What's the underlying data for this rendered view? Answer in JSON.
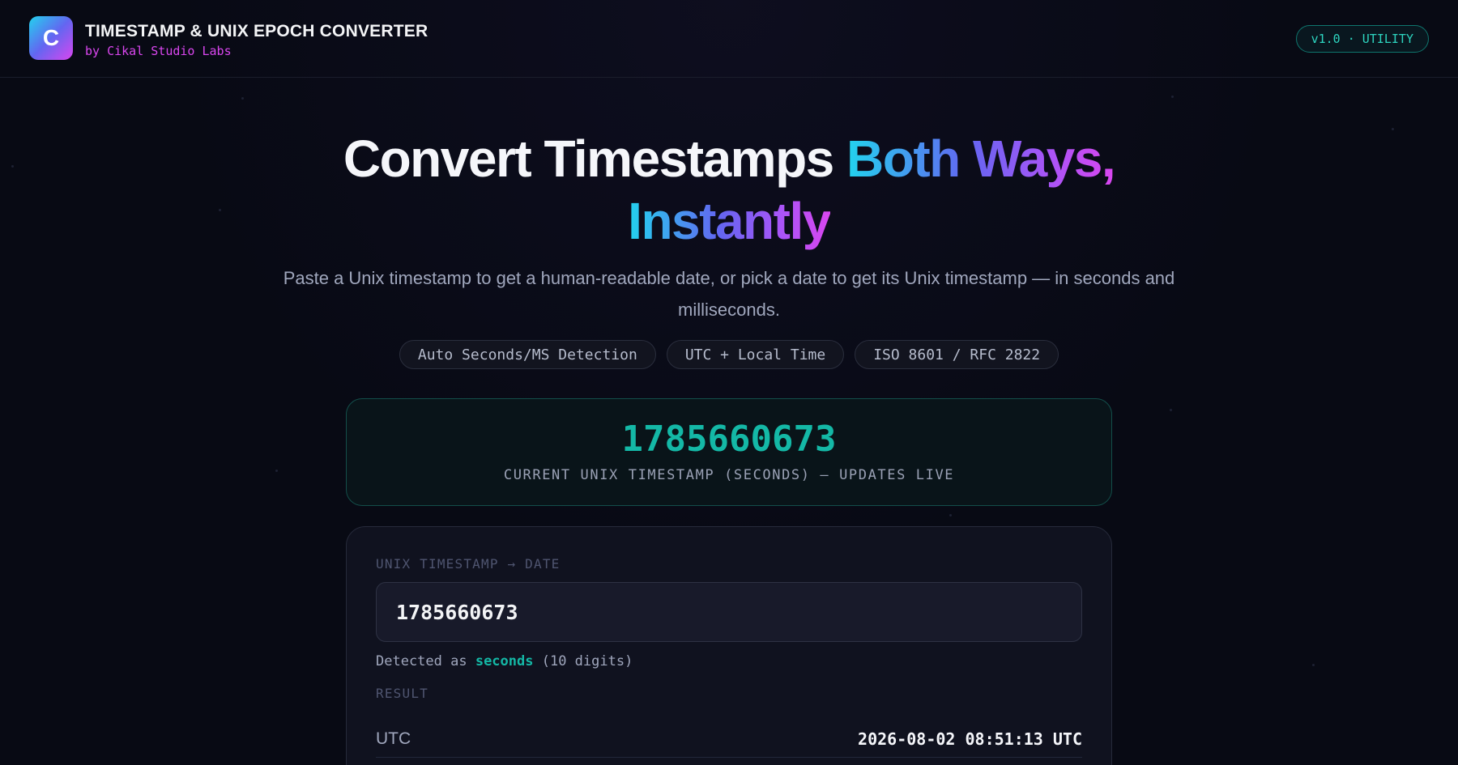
{
  "header": {
    "logo_letter": "C",
    "title": "TIMESTAMP & UNIX EPOCH CONVERTER",
    "subtitle": "by Cikal Studio Labs",
    "version_badge": "v1.0 · UTILITY"
  },
  "hero": {
    "title_part1": "Convert Timestamps ",
    "title_part2": "Both Ways,",
    "title_part3": "Instantly",
    "description": "Paste a Unix timestamp to get a human-readable date, or pick a date to get its Unix timestamp — in seconds and milliseconds."
  },
  "chips": [
    "Auto Seconds/MS Detection",
    "UTC + Local Time",
    "ISO 8601 / RFC 2822"
  ],
  "live": {
    "value": "1785660673",
    "caption": "CURRENT UNIX TIMESTAMP (SECONDS) — UPDATES LIVE"
  },
  "converter": {
    "section_label": "UNIX TIMESTAMP → DATE",
    "input_value": "1785660673",
    "detected_prefix": "Detected as ",
    "detected_unit": "seconds",
    "detected_suffix": " (10 digits)",
    "result_label": "RESULT",
    "results": [
      {
        "key": "UTC",
        "value": "2026-08-02 08:51:13 UTC"
      }
    ]
  },
  "colors": {
    "background": "#080a14",
    "accent_teal": "#14b8a6",
    "accent_magenta": "#d946ef",
    "gradient": [
      "#22d3ee",
      "#6366f1",
      "#a855f7",
      "#d946ef"
    ]
  }
}
